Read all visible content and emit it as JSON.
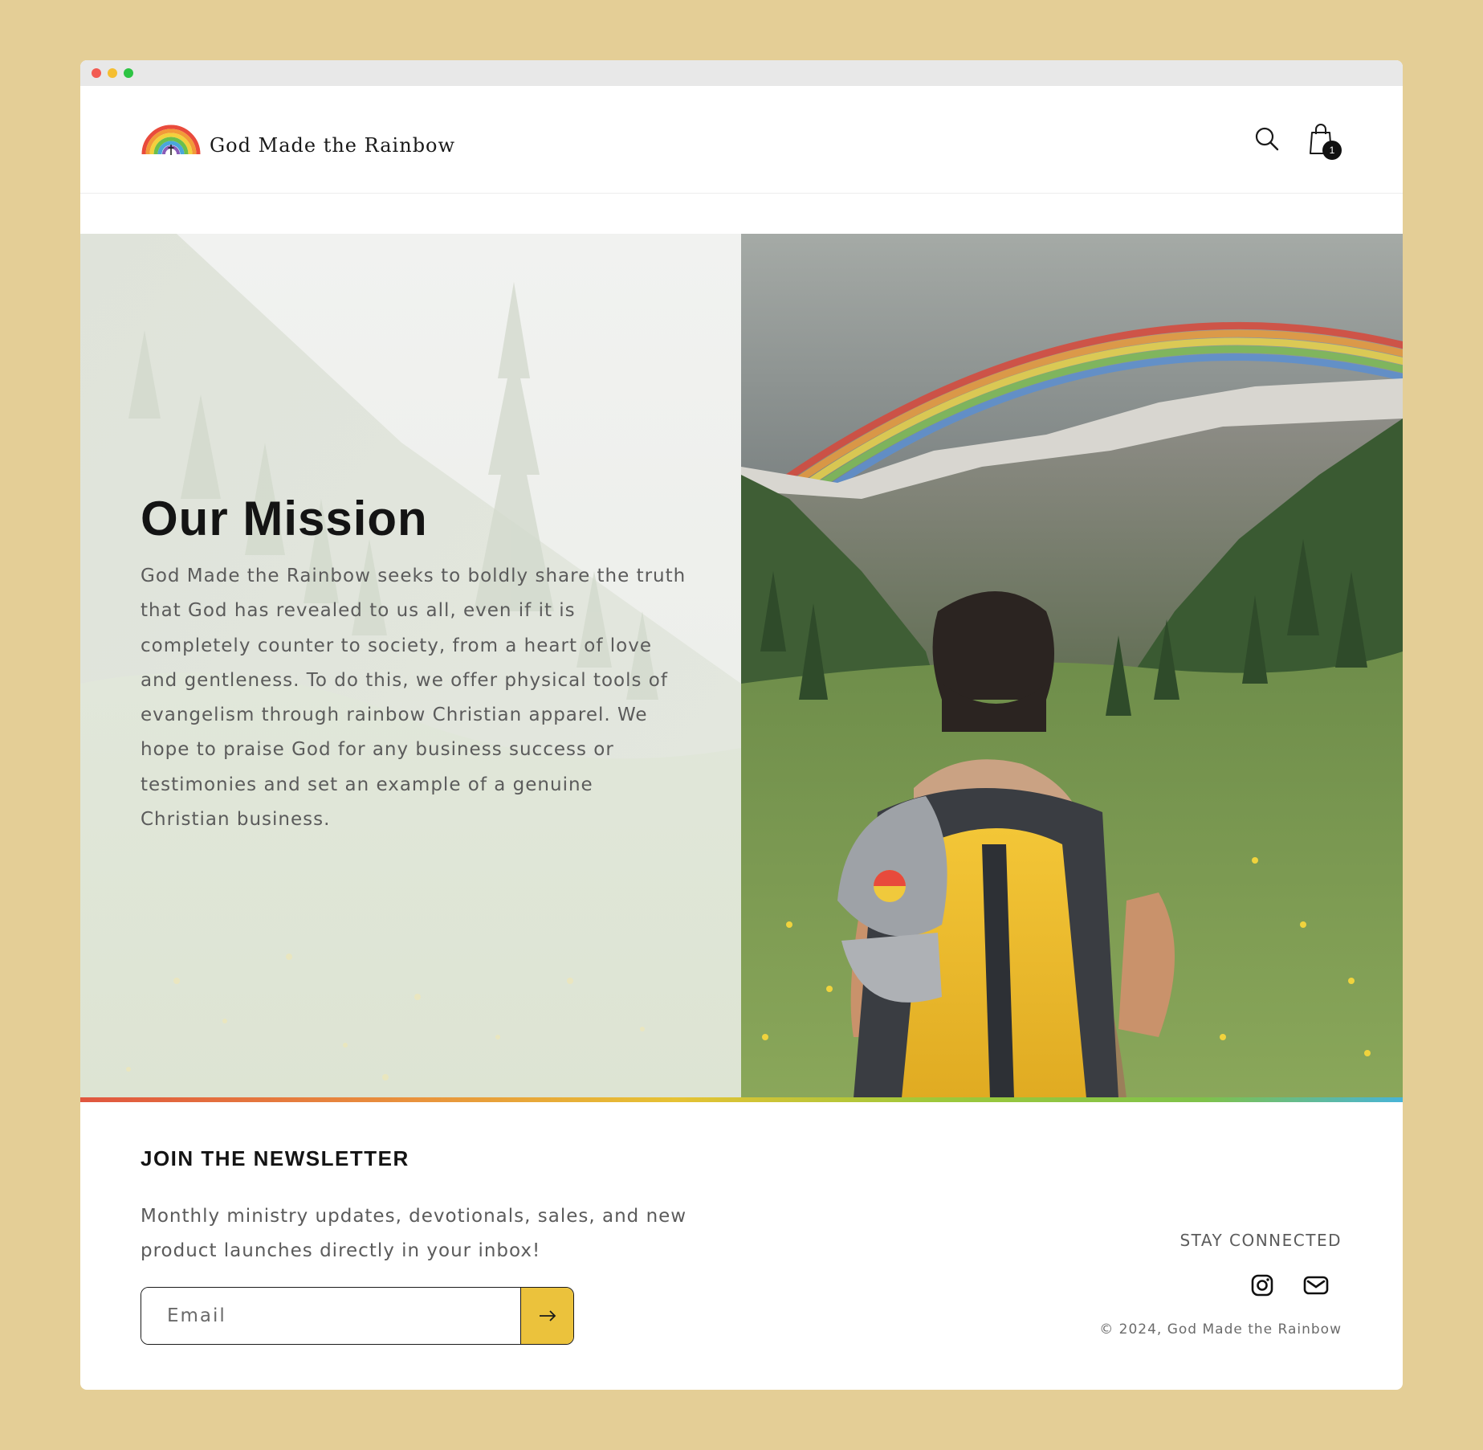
{
  "site": {
    "name": "God Made the Rainbow",
    "logo_icon": "rainbow-cross-logo"
  },
  "header": {
    "search_icon": "search-icon",
    "cart_icon": "shopping-bag-icon",
    "cart_count": "1"
  },
  "hero": {
    "title": "Our Mission",
    "body": "God Made the Rainbow seeks to boldly share the truth that God has revealed to us all, even if it is completely counter to society, from a heart of love and gentleness. To do this, we offer physical tools of evangelism through rainbow Christian apparel. We hope to praise God for any business success or testimonies and set an example of a genuine Christian business."
  },
  "newsletter": {
    "title": "JOIN THE NEWSLETTER",
    "text": "Monthly ministry updates, devotionals, sales, and new product launches directly in your inbox!",
    "email_placeholder": "Email",
    "submit_icon": "arrow-right-icon"
  },
  "footer": {
    "stay_connected": "STAY CONNECTED",
    "social": [
      "instagram-icon",
      "mail-icon"
    ],
    "copyright": "© 2024, God Made the Rainbow"
  },
  "colors": {
    "page_background": "#e4ce96",
    "accent_yellow": "#ebc23c",
    "text_dark": "#141414",
    "text_muted": "#5b5b5b"
  }
}
